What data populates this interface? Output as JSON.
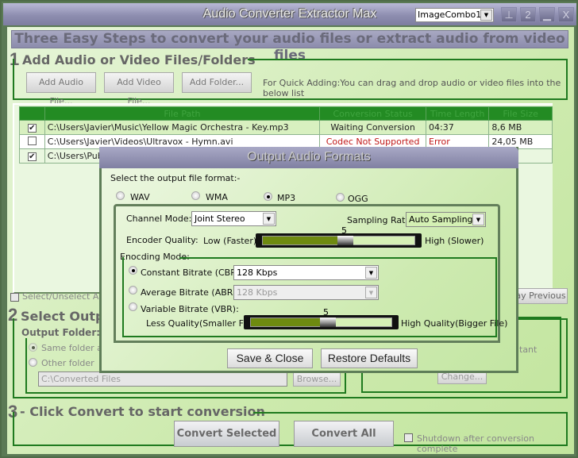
{
  "window": {
    "title": "Audio Converter Extractor Max",
    "combo_value": "ImageCombo1",
    "title_buttons": [
      {
        "name": "pin",
        "glyph": "⊥"
      },
      {
        "name": "help",
        "glyph": "2"
      },
      {
        "name": "minimize",
        "glyph": "▁"
      },
      {
        "name": "close",
        "glyph": "X"
      }
    ]
  },
  "banner": "Three Easy Steps to convert your audio files or extract audio from video files",
  "step1": {
    "number": "1",
    "title": "Add Audio or Video Files/Folders",
    "buttons": {
      "add_audio": "Add Audio File...",
      "add_video": "Add Video File...",
      "add_folder": "Add Folder..."
    },
    "hint": "For Quick Adding:You can drag and drop audio or video files into the below list"
  },
  "file_list": {
    "columns": [
      "",
      "File Path",
      "Conversion Status",
      "Time Length",
      "File Size"
    ],
    "rows": [
      {
        "checked": true,
        "path": "C:\\Users\\Javier\\Music\\Yellow Magic Orchestra - Key.mp3",
        "status": "Waiting Conversion",
        "length": "04:37",
        "size": "8,6 MB",
        "error": false
      },
      {
        "checked": false,
        "path": "C:\\Users\\Javier\\Videos\\Ultravox  -  Hymn.avi",
        "status": "Codec Not Supported",
        "length": "Error",
        "size": "24,05 MB",
        "error": true
      },
      {
        "checked": true,
        "path": "C:\\Users\\Public",
        "status": "",
        "length": "",
        "size": "",
        "error": false
      }
    ],
    "select_all_label": "Select/Unselect All",
    "play_previous_label": "ay Previous"
  },
  "step2": {
    "number": "2",
    "title": "Select Outpu",
    "output_folder_label": "Output Folder: -",
    "same_folder_label": "Same folder as",
    "other_folder_label": "Other folder",
    "folder_path": "C:\\Converted Files",
    "browse_label": "Browse...",
    "constant_fragment": "tant",
    "change_label": "Change..."
  },
  "step3": {
    "number": "3",
    "title": "- Click Convert to start conversion",
    "convert_selected": "Convert Selected",
    "convert_all": "Convert All",
    "shutdown_label": "Shutdown after conversion complete",
    "shutdown_checked": false
  },
  "dialog": {
    "title": "Output Audio Formats",
    "select_format_label": "Select the output file format:-",
    "formats": [
      {
        "label": "WAV",
        "selected": false
      },
      {
        "label": "WMA",
        "selected": false
      },
      {
        "label": "MP3",
        "selected": true
      },
      {
        "label": "OGG",
        "selected": false
      }
    ],
    "channel_mode_label": "Channel Mode:",
    "channel_mode_value": "Joint Stereo",
    "sampling_rate_label": "Sampling Rate:",
    "sampling_rate_value": "Auto Sampling",
    "encoder_quality_label": "Encoder Quality:",
    "encoder_low_label": "Low (Faster)",
    "encoder_high_label": "High (Slower)",
    "encoder_quality_value": "5",
    "encoder_quality_fraction": 0.5,
    "encoding_mode_label": "Enocding Mode:",
    "cbr_label": "Constant Bitrate (CBR):",
    "cbr_value": "128 Kbps",
    "abr_label": "Average Bitrate (ABR):",
    "abr_value": "128 Kbps",
    "vbr_label": "Variable Bitrate (VBR):",
    "encoding_mode_selected": "CBR",
    "vbr_low_label": "Less Quality(Smaller File)",
    "vbr_high_label": "High Quality(Bigger File)",
    "vbr_value": "5",
    "vbr_fraction": 0.5,
    "save_label": "Save & Close",
    "restore_label": "Restore Defaults"
  }
}
